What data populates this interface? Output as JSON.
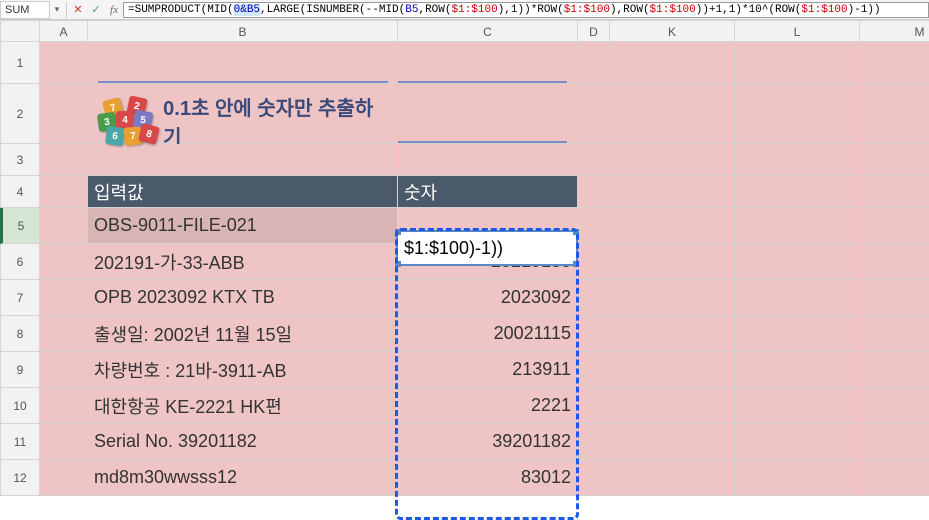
{
  "name_box": "SUM",
  "formula_html": "=SUMPRODUCT(MID(<span class='ref-hl'>0&B5</span>,LARGE(ISNUMBER(--MID(<span class='ref2'>B5</span>,ROW(<span class='ref'>$1:$100</span>),1))*ROW(<span class='ref'>$1:$100</span>),ROW(<span class='ref'>$1:$100</span>))+1,1)*10^(ROW(<span class='ref'>$1:$100</span>)-1))",
  "columns": [
    "",
    "A",
    "B",
    "C",
    "D",
    "K",
    "L",
    "M"
  ],
  "row_headers": [
    "1",
    "2",
    "3",
    "4",
    "5",
    "6",
    "7",
    "8",
    "9",
    "10",
    "11",
    "12"
  ],
  "active_row": "5",
  "title": "0.1초 안에 숫자만 추출하기",
  "blocks": [
    "7",
    "2",
    "3",
    "4",
    "5",
    "6",
    "7",
    "8"
  ],
  "table_header": {
    "col1": "입력값",
    "col2": "숫자"
  },
  "editing_cell_display": "$1:$100)-1))",
  "rows": [
    {
      "input": "OBS-9011-FILE-021",
      "num": ""
    },
    {
      "input": "202191-가-33-ABB",
      "num": "20219133"
    },
    {
      "input": "OPB 2023092 KTX TB",
      "num": "2023092"
    },
    {
      "input": "출생일: 2002년 11월 15일",
      "num": "20021115"
    },
    {
      "input": "차량번호 : 21바-3911-AB",
      "num": "213911"
    },
    {
      "input": "대한항공 KE-2221 HK편",
      "num": "2221"
    },
    {
      "input": "Serial No. 39201182",
      "num": "39201182"
    },
    {
      "input": "md8m30wwsss12",
      "num": "83012"
    }
  ]
}
